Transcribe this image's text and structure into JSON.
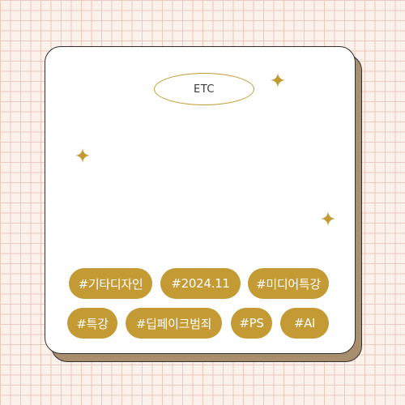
{
  "card": {
    "badge": "ETC"
  },
  "tags": [
    "#기타디자인",
    "#2024.11",
    "#미디어특강",
    "#특강",
    "#딥페이크범죄",
    "#PS",
    "#AI"
  ],
  "colors": {
    "background": "#faf1eb",
    "grid_line": "#ecc9ba",
    "card": "#ffffff",
    "card_shadow": "#a98e6d",
    "accent_gold": "#c39a33",
    "tag_text": "#ffffff"
  },
  "icons": [
    "sparkle-icon",
    "sparkle-icon",
    "sparkle-icon"
  ]
}
